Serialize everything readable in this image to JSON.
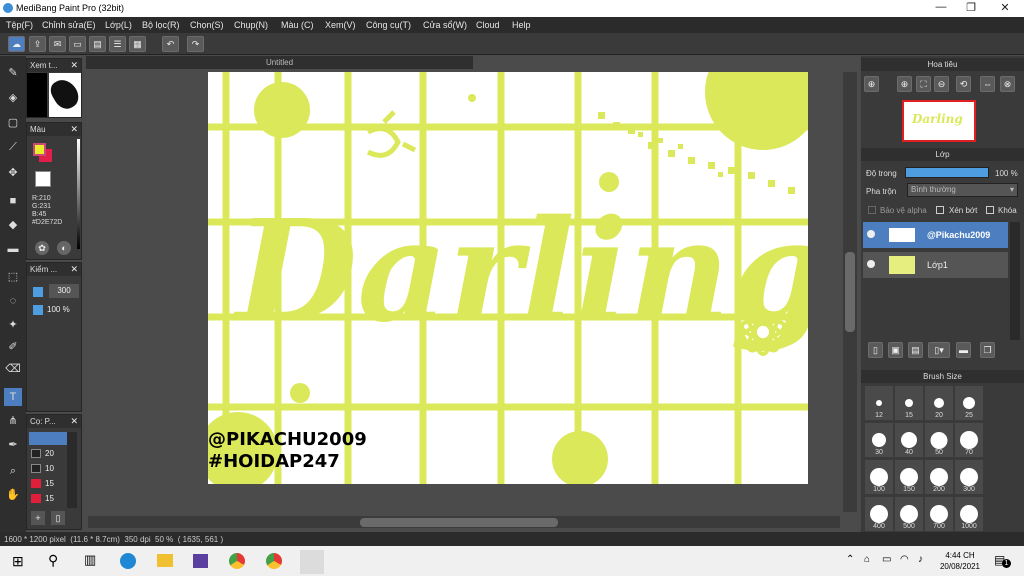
{
  "app": {
    "title": "MediBang Paint Pro (32bit)"
  },
  "menu": [
    "Tệp(F)",
    "Chỉnh sửa(E)",
    "Lớp(L)",
    "Bộ lọc(R)",
    "Chọn(S)",
    "Chụp(N)",
    "Màu (C)",
    "Xem(V)",
    "Công cụ(T)",
    "Cửa sổ(W)",
    "Cloud",
    "Help"
  ],
  "window_controls": {
    "minimize": "—",
    "maximize": "❐",
    "close": "✕"
  },
  "panels": {
    "brush_preview": {
      "title": "Xem t..."
    },
    "color": {
      "title": "Màu",
      "r": "R:210",
      "g": "G:231",
      "b": "B:45",
      "hex": "#D2E72D",
      "fg": "#e8ee2a",
      "bg": "#e0204a"
    },
    "check": {
      "title": "Kiểm ...",
      "size": "300",
      "opacity": "100 %"
    },
    "pen": {
      "title": "Cọ: P...",
      "items": [
        "20",
        "10",
        "15",
        "15"
      ]
    }
  },
  "document": {
    "tab": "Untitled"
  },
  "canvas": {
    "word": "Darling",
    "line1": "@PIKACHU2009",
    "line2": "#HOIDAP247",
    "accent": "#dbe85a"
  },
  "navigator": {
    "title": "Hoa tiêu"
  },
  "layers": {
    "title": "Lớp",
    "opacity_label": "Độ trong",
    "opacity_value": "100 %",
    "opacity_fraction": 1.0,
    "blend_label": "Pha trộn",
    "blend_value": "Bình thường",
    "protect_alpha": "Bảo vệ alpha",
    "clipping": "Xén bớt",
    "lock": "Khóa",
    "items": [
      {
        "name": "@Pikachu2009"
      },
      {
        "name": "Lớp1"
      }
    ]
  },
  "brush_size": {
    "title": "Brush Size",
    "sizes": [
      "12",
      "15",
      "20",
      "25",
      "30",
      "40",
      "50",
      "70",
      "100",
      "150",
      "200",
      "300",
      "400",
      "500",
      "700",
      "1000"
    ]
  },
  "status": {
    "info": "1600 * 1200 pixel  (11.6 * 8.7cm)  350 dpi  50 %  ( 1635, 561 )"
  },
  "taskbar": {
    "time": "4:44 CH",
    "date": "20/08/2021",
    "notif": "1"
  }
}
